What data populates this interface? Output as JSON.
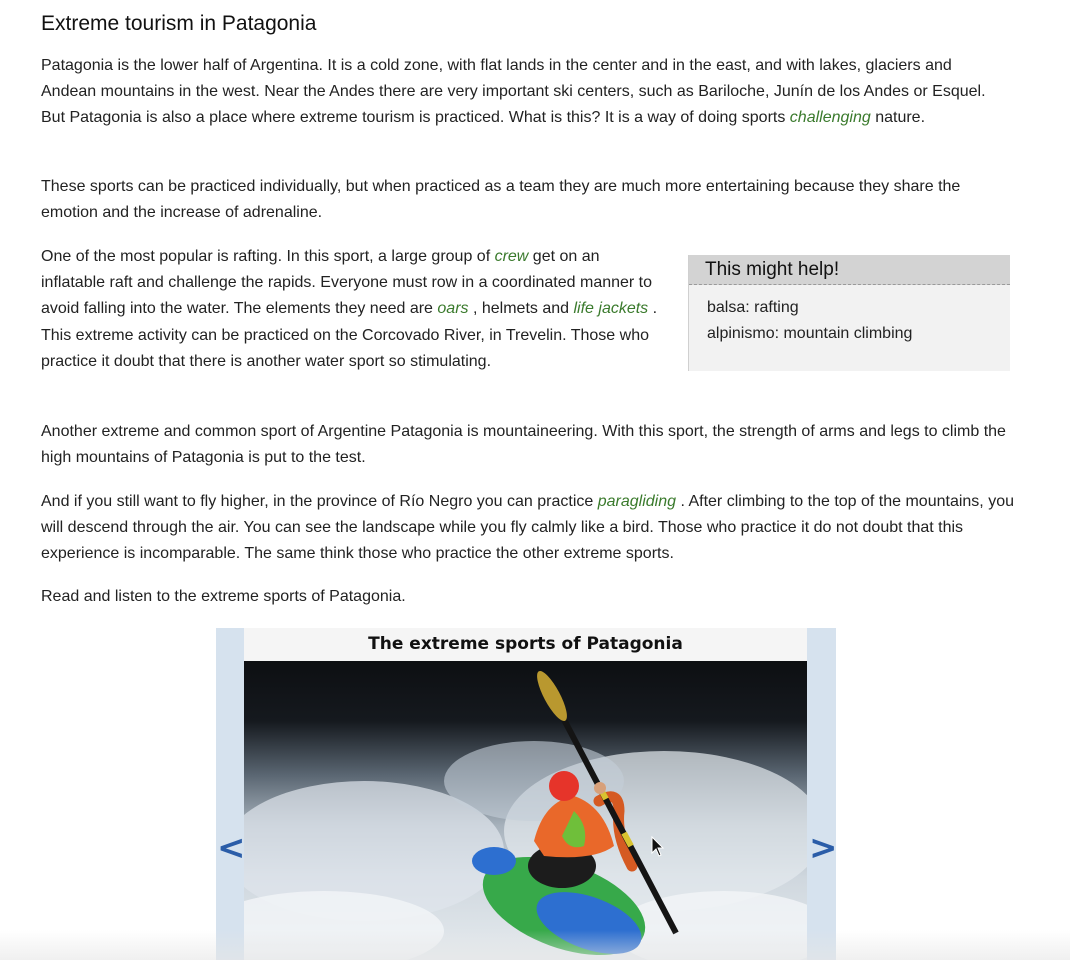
{
  "article": {
    "title": "Extreme tourism in Patagonia",
    "p1": {
      "before": "Patagonia is the lower half of Argentina. It is a cold zone, with flat lands in the center and in the east, and with lakes, glaciers and Andean mountains in the west. Near the Andes there are very important ski centers, such as Bariloche, Junín de los Andes or Esquel. But Patagonia is also a place where extreme tourism is practiced. What is this? It is a way of doing sports ",
      "term": "challenging",
      "after": " nature."
    },
    "p2": "These sports can be practiced individually, but when practiced as a team they are much more entertaining because they share the emotion and the increase of adrenaline.",
    "p3": {
      "a": "One of the most popular is rafting. In this sport, a large group of ",
      "term1": "crew",
      "b": " get on an inflatable raft and challenge the rapids. Everyone must row in a coordinated manner to avoid falling into the water. The elements they need are ",
      "term2": "oars",
      "c": " , helmets and ",
      "term3": "life jackets",
      "d": " . This extreme activity can be practiced on the Corcovado River, in Trevelin. Those who practice it doubt that there is another water sport so stimulating."
    },
    "p4": "Another extreme and common sport of Argentine Patagonia is mountaineering. With this sport, the strength of arms and legs to climb the high mountains of Patagonia is put to the test.",
    "p5": {
      "before": "And if you still want to fly higher, in the province of Río Negro you can practice ",
      "term": "paragliding",
      "after": " . After climbing to the top of the mountains, you will descend through the air. You can see the landscape while you fly calmly like a bird. Those who practice it do not doubt that this experience is incomparable. The same think those who practice the other extreme sports."
    },
    "p6": "Read and listen to the extreme sports of Patagonia."
  },
  "help_box": {
    "title": "This might help!",
    "items": [
      "balsa: rafting",
      "alpinismo: mountain climbing"
    ]
  },
  "carousel": {
    "title": "The extreme sports of Patagonia",
    "prev_label": "<",
    "next_label": ">"
  },
  "colors": {
    "glossary_term": "#3a7a2c",
    "help_header": "#d3d3d3",
    "carousel_frame": "#d6e2ee",
    "arrow": "#2b5da8"
  }
}
